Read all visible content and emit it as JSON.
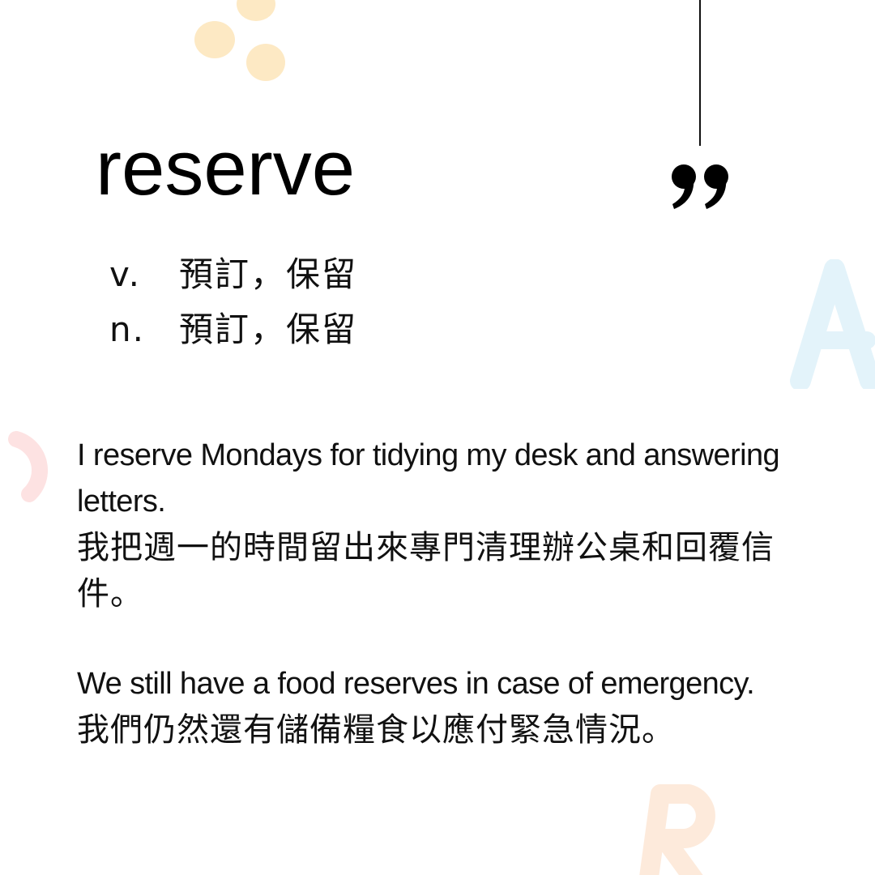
{
  "word": {
    "headword": "reserve",
    "senses": [
      {
        "pos": "v.",
        "meaning": "預訂，保留"
      },
      {
        "pos": "n.",
        "meaning": "預訂，保留"
      }
    ]
  },
  "examples": [
    {
      "english": "I reserve Mondays for tidying my desk and answering letters.",
      "chinese_lines": [
        "我把週一的時間留出來專門清理辦公桌和回覆信",
        "件。"
      ]
    },
    {
      "english": "We still have a food reserves in case of emergency.",
      "chinese_lines": [
        "我們仍然還有儲備糧食以應付緊急情況。"
      ]
    }
  ],
  "decorations": {
    "quote_icon": "closing-quote-icon",
    "accent_colors": {
      "yellow": "#fde9c4",
      "blue": "#e3f3fa",
      "pink": "#fde2e2",
      "peach": "#fdeadb"
    }
  }
}
